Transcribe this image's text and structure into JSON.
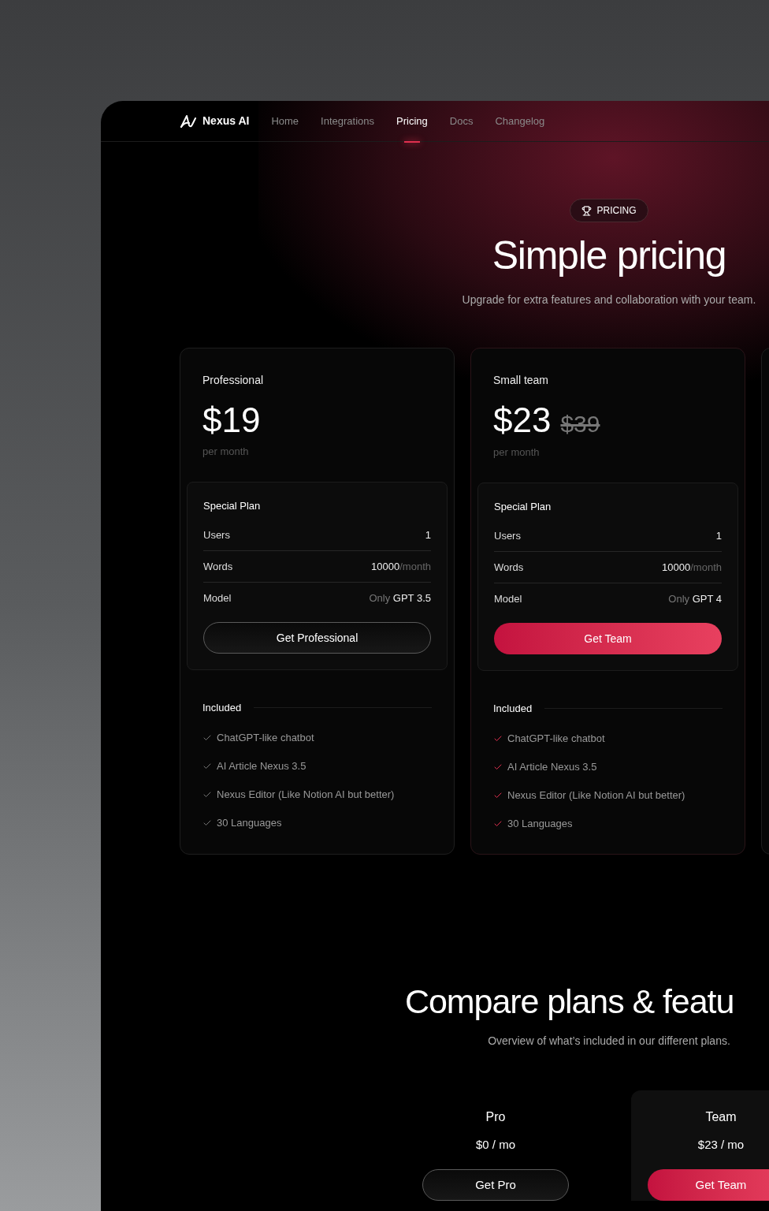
{
  "nav": {
    "brand": "Nexus AI",
    "links": [
      {
        "label": "Home",
        "selected": false
      },
      {
        "label": "Integrations",
        "selected": false
      },
      {
        "label": "Pricing",
        "selected": true
      },
      {
        "label": "Docs",
        "selected": false
      },
      {
        "label": "Changelog",
        "selected": false
      }
    ]
  },
  "hero": {
    "badge": "PRICING",
    "title": "Simple pricing",
    "subtitle": "Upgrade for extra features and collaboration with your team."
  },
  "plans": [
    {
      "name": "Professional",
      "price": "$19",
      "period": "per month",
      "highlighted": false,
      "special_title": "Special Plan",
      "rows": [
        {
          "label": "Users",
          "value": "1"
        },
        {
          "label": "Words",
          "value": "10000",
          "suffix": "/month"
        },
        {
          "label": "Model",
          "prefix": "Only",
          "value": "GPT 3.5"
        }
      ],
      "button": "Get Professional",
      "included_title": "Included",
      "features": [
        "ChatGPT-like chatbot",
        "AI Article Nexus 3.5",
        "Nexus Editor (Like Notion AI but better)",
        "30 Languages"
      ]
    },
    {
      "name": "Small team",
      "price": "$23",
      "old_price": "$39",
      "period": "per month",
      "highlighted": true,
      "special_title": "Special Plan",
      "rows": [
        {
          "label": "Users",
          "value": "1"
        },
        {
          "label": "Words",
          "value": "10000",
          "suffix": "/month"
        },
        {
          "label": "Model",
          "prefix": "Only",
          "value": "GPT 4"
        }
      ],
      "button": "Get Team",
      "included_title": "Included",
      "features": [
        "ChatGPT-like chatbot",
        "AI Article Nexus 3.5",
        "Nexus Editor (Like Notion AI but better)",
        "30 Languages"
      ]
    }
  ],
  "compare": {
    "title": "Compare plans & featu",
    "subtitle": "Overview of what’s included in our different plans.",
    "plans": [
      {
        "name": "Pro",
        "price": "$0 / mo",
        "button": "Get Pro",
        "highlighted": false
      },
      {
        "name": "Team",
        "price": "$23 / mo",
        "button": "Get Team",
        "highlighted": true
      }
    ]
  }
}
